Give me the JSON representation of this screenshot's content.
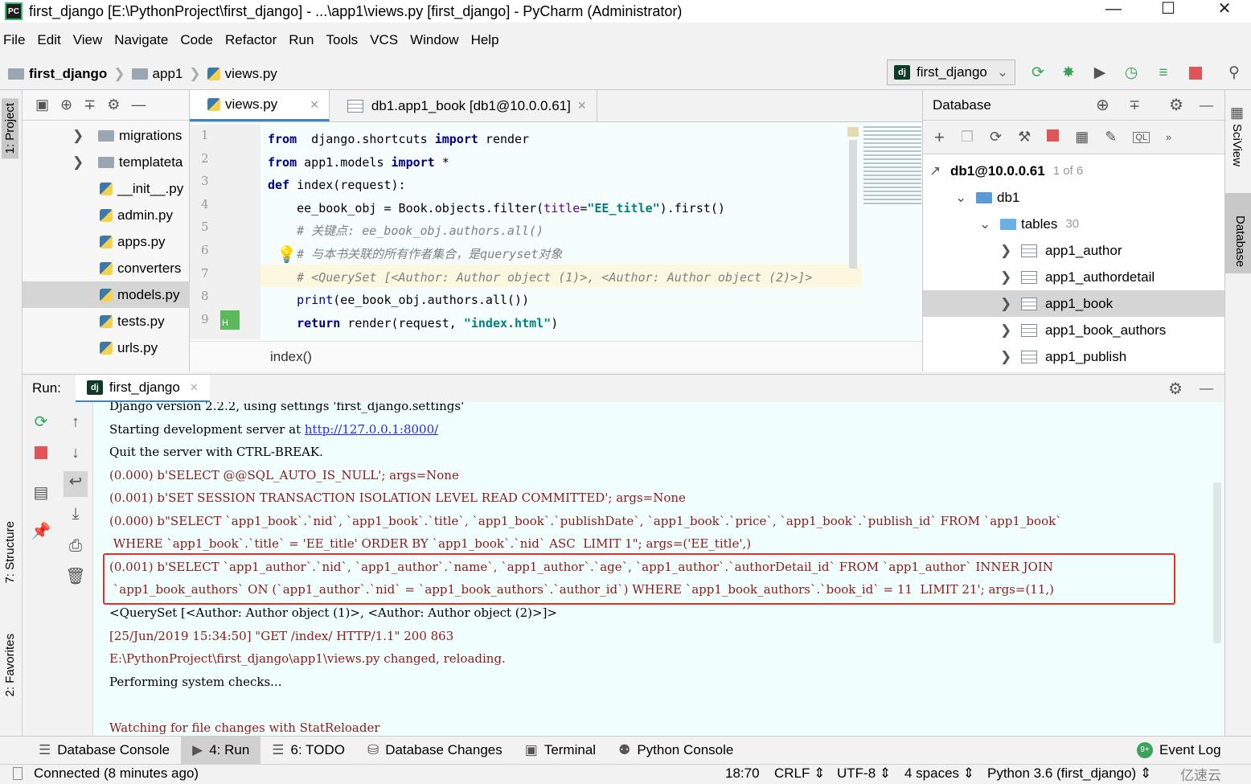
{
  "window": {
    "title": "first_django [E:\\PythonProject\\first_django] - ...\\app1\\views.py [first_django] - PyCharm (Administrator)",
    "logo": "PC"
  },
  "menu": [
    "File",
    "Edit",
    "View",
    "Navigate",
    "Code",
    "Refactor",
    "Run",
    "Tools",
    "VCS",
    "Window",
    "Help"
  ],
  "breadcrumb": [
    "first_django",
    "app1",
    "views.py"
  ],
  "run_config": {
    "badge": "dj",
    "name": "first_django"
  },
  "left_stripe": {
    "project": "1: Project",
    "structure": "7: Structure",
    "favorites": "2: Favorites"
  },
  "project_tree": [
    {
      "label": "migrations",
      "type": "folder",
      "arrow": true
    },
    {
      "label": "templateta",
      "type": "folder",
      "arrow": true
    },
    {
      "label": "__init__.py",
      "type": "py"
    },
    {
      "label": "admin.py",
      "type": "py"
    },
    {
      "label": "apps.py",
      "type": "py"
    },
    {
      "label": "converters",
      "type": "py"
    },
    {
      "label": "models.py",
      "type": "py",
      "selected": true
    },
    {
      "label": "tests.py",
      "type": "py"
    },
    {
      "label": "urls.py",
      "type": "py"
    }
  ],
  "editor": {
    "tabs": [
      {
        "label": "views.py",
        "active": true
      },
      {
        "label": "db1.app1_book [db1@10.0.0.61]"
      }
    ],
    "line_numbers": [
      "1",
      "2",
      "3",
      "4",
      "5",
      "6",
      "7",
      "8",
      "9"
    ],
    "code": [
      [
        [
          "kw",
          "from"
        ],
        [
          "",
          "  django.shortcuts "
        ],
        [
          "kw",
          "import"
        ],
        [
          "",
          " render"
        ]
      ],
      [
        [
          "kw",
          "from"
        ],
        [
          "",
          " app1.models "
        ],
        [
          "kw",
          "import"
        ],
        [
          "",
          " *"
        ]
      ],
      [
        [
          "kw",
          "def"
        ],
        [
          "",
          " index(request):"
        ]
      ],
      [
        [
          "",
          "    ee_book_obj = Book.objects.filter("
        ],
        [
          "param",
          "title"
        ],
        [
          "",
          "="
        ],
        [
          "str",
          "\"EE_title\""
        ],
        [
          "",
          ").first()"
        ]
      ],
      [
        [
          "cmt",
          "    # 关键点: ee_book_obj.authors.all()"
        ]
      ],
      [
        [
          "cmt",
          "    # 与本书关联的所有作者集合，是queryset对象"
        ]
      ],
      [
        [
          "cmt",
          "    # <QuerySet [<Author: Author object (1)>, <Author: Author object (2)>]>"
        ]
      ],
      [
        [
          "bi",
          "    print"
        ],
        [
          "",
          "(ee_book_obj.authors.all())"
        ]
      ],
      [
        [
          "kw",
          "    return"
        ],
        [
          "",
          " render(request, "
        ],
        [
          "str",
          "\"index.html\""
        ],
        [
          ")",
          ")"
        ]
      ]
    ],
    "scope_breadcrumb": "index()"
  },
  "database": {
    "title": "Database",
    "tree": [
      {
        "label": "db1@10.0.0.61",
        "suffix": "1 of 6",
        "level": 0
      },
      {
        "label": "db1",
        "level": 1,
        "expanded": true
      },
      {
        "label": "tables",
        "suffix": "30",
        "level": 2,
        "expanded": true
      },
      {
        "label": "app1_author",
        "level": 3
      },
      {
        "label": "app1_authordetail",
        "level": 3
      },
      {
        "label": "app1_book",
        "level": 3,
        "selected": true
      },
      {
        "label": "app1_book_authors",
        "level": 3
      },
      {
        "label": "app1_publish",
        "level": 3
      }
    ]
  },
  "right_stripe": {
    "sciview": "SciView",
    "database": "Database"
  },
  "run": {
    "label": "Run:",
    "tab": "first_django",
    "console": [
      {
        "text": "Django version 2.2.2, using settings 'first_django.settings'",
        "err": false
      },
      {
        "text": "Starting development server at ",
        "link": "http://127.0.0.1:8000/",
        "err": false
      },
      {
        "text": "Quit the server with CTRL-BREAK.",
        "err": false
      },
      {
        "text": "(0.000) b'SELECT @@SQL_AUTO_IS_NULL'; args=None",
        "err": true
      },
      {
        "text": "(0.001) b'SET SESSION TRANSACTION ISOLATION LEVEL READ COMMITTED'; args=None",
        "err": true
      },
      {
        "text": "(0.000) b\"SELECT `app1_book`.`nid`, `app1_book`.`title`, `app1_book`.`publishDate`, `app1_book`.`price`, `app1_book`.`publish_id` FROM `app1_book`",
        "err": true
      },
      {
        "text": " WHERE `app1_book`.`title` = 'EE_title' ORDER BY `app1_book`.`nid` ASC  LIMIT 1\"; args=('EE_title',)",
        "err": true
      },
      {
        "text": "(0.001) b'SELECT `app1_author`.`nid`, `app1_author`.`name`, `app1_author`.`age`, `app1_author`.`authorDetail_id` FROM `app1_author` INNER JOIN",
        "err": true
      },
      {
        "text": " `app1_book_authors` ON (`app1_author`.`nid` = `app1_book_authors`.`author_id`) WHERE `app1_book_authors`.`book_id` = 11  LIMIT 21'; args=(11,)",
        "err": true
      },
      {
        "text": "<QuerySet [<Author: Author object (1)>, <Author: Author object (2)>]>",
        "err": false
      },
      {
        "text": "[25/Jun/2019 15:34:50] \"GET /index/ HTTP/1.1\" 200 863",
        "err": true
      },
      {
        "text": "E:\\PythonProject\\first_django\\app1\\views.py changed, reloading.",
        "err": true
      },
      {
        "text": "Performing system checks...",
        "err": false
      },
      {
        "text": "",
        "err": false
      },
      {
        "text": "Watching for file changes with StatReloader",
        "err": true
      }
    ]
  },
  "bottom_tools": [
    {
      "label": "Database Console",
      "icon": "database-console-icon"
    },
    {
      "label": "4: Run",
      "icon": "run-icon",
      "active": true
    },
    {
      "label": "6: TODO",
      "icon": "todo-icon"
    },
    {
      "label": "Database Changes",
      "icon": "database-changes-icon"
    },
    {
      "label": "Terminal",
      "icon": "terminal-icon"
    },
    {
      "label": "Python Console",
      "icon": "python-console-icon"
    }
  ],
  "event_log": {
    "label": "Event Log",
    "badge": "9+"
  },
  "status": {
    "message": "Connected (8 minutes ago)",
    "position": "18:70",
    "line_sep": "CRLF",
    "encoding": "UTF-8",
    "indent": "4 spaces",
    "interpreter": "Python 3.6 (first_django)",
    "watermark": "亿速云"
  },
  "colors": {
    "accent": "#4083c9",
    "highlight_box": "#e0302a",
    "console_bg": "#f0fffe",
    "editor_bg": "#f5fdfd"
  }
}
